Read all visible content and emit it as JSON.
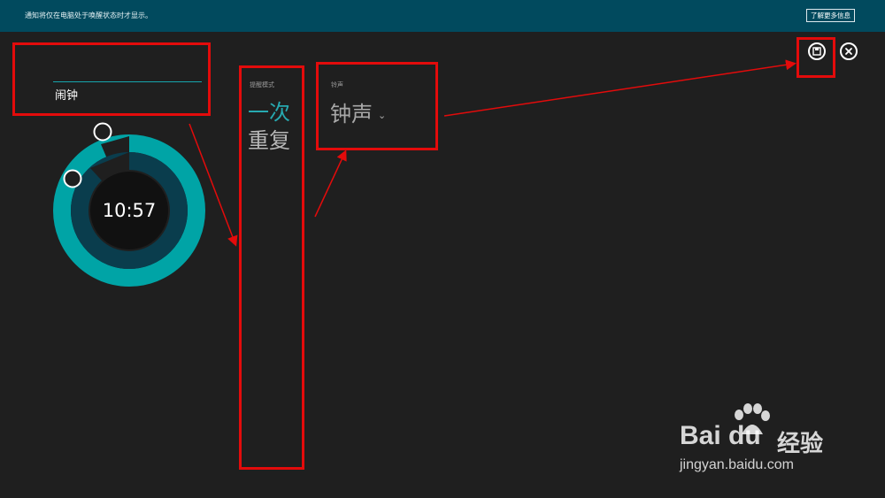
{
  "banner": {
    "text": "通知将仅在电脑处于唤醒状态时才显示。",
    "learn_more": "了解更多信息"
  },
  "alarm": {
    "name": "闹钟",
    "time": "10:57"
  },
  "remind_mode": {
    "label": "提醒模式",
    "options": [
      "一次",
      "重复"
    ],
    "selected": "一次"
  },
  "ringtone": {
    "label": "铃声",
    "value": "钟声"
  },
  "actions": {
    "save_icon": "save-icon",
    "close_icon": "close-icon"
  },
  "watermark": {
    "logo": "Bai du",
    "brand": "经验",
    "url": "jingyan.baidu.com"
  },
  "colors": {
    "banner": "#014a5e",
    "background": "#1f1f1f",
    "accent": "#00a4a6",
    "highlight": "#e30b0b"
  }
}
